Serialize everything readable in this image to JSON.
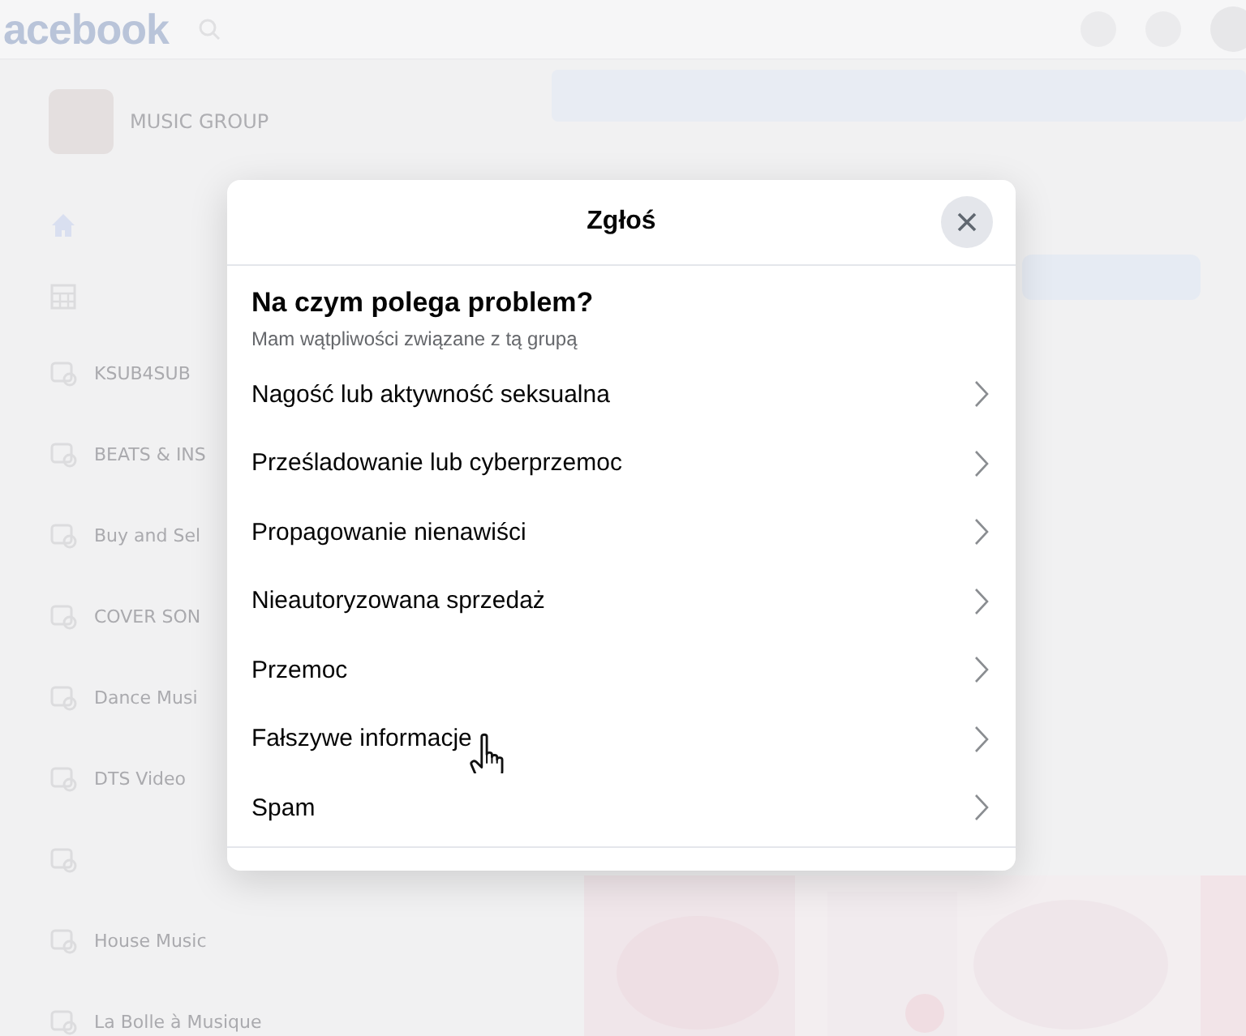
{
  "top_bar": {
    "logo": "acebook"
  },
  "sidebar": {
    "group": {
      "name": "MUSIC GROUP"
    },
    "items": [
      {
        "kind": "home"
      },
      {
        "kind": "grid"
      },
      {
        "kind": "group",
        "title": "KSUB4SUB"
      },
      {
        "kind": "group",
        "title": "BEATS & INS"
      },
      {
        "kind": "group",
        "title": "Buy and Sel"
      },
      {
        "kind": "group",
        "title": "COVER SON"
      },
      {
        "kind": "group",
        "title": "Dance Musi"
      },
      {
        "kind": "group",
        "title": "DTS Video"
      },
      {
        "kind": "group"
      },
      {
        "kind": "group",
        "title": "House Music"
      },
      {
        "kind": "group",
        "title": "La Bolle à Musique"
      }
    ]
  },
  "dialog": {
    "title": "Zgłoś",
    "question": "Na czym polega problem?",
    "subtitle": "Mam wątpliwości związane z tą grupą",
    "options": [
      {
        "label": "Nagość lub aktywność seksualna",
        "hovered": false
      },
      {
        "label": "Prześladowanie lub cyberprzemoc",
        "hovered": false
      },
      {
        "label": "Propagowanie nienawiści",
        "hovered": false
      },
      {
        "label": "Nieautoryzowana sprzedaż",
        "hovered": false
      },
      {
        "label": "Przemoc",
        "hovered": false
      },
      {
        "label": "Fałszywe informacje",
        "hovered": true
      },
      {
        "label": "Spam",
        "hovered": false
      }
    ]
  }
}
